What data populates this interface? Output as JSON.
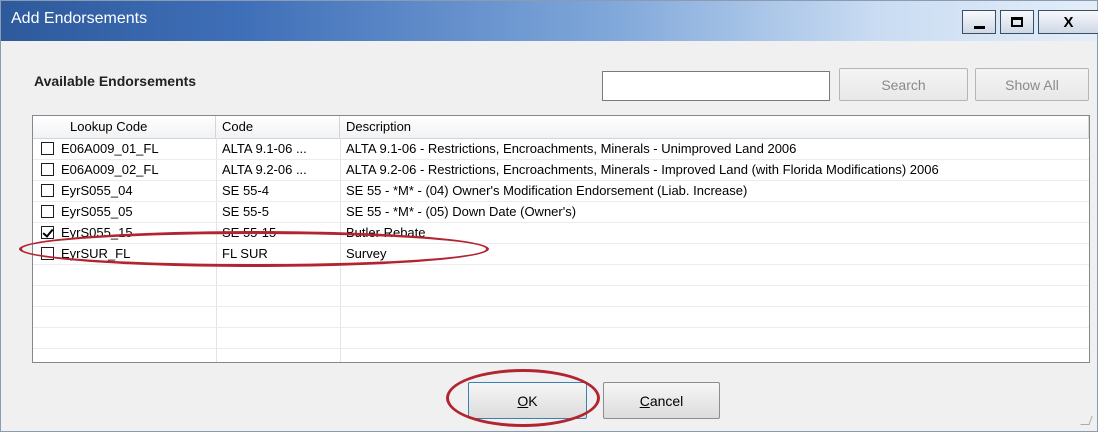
{
  "window": {
    "title": "Add Endorsements",
    "controls": {
      "close_glyph": "X"
    }
  },
  "group": {
    "label": "Available Endorsements"
  },
  "search": {
    "value": "",
    "button_label": "Search",
    "show_all_label": "Show All"
  },
  "table": {
    "columns": [
      "Lookup Code",
      "Code",
      "Description"
    ],
    "rows": [
      {
        "checked": false,
        "lookup": "E06A009_01_FL",
        "code": "ALTA 9.1-06 ...",
        "description": "ALTA 9.1-06 - Restrictions, Encroachments, Minerals - Unimproved Land 2006"
      },
      {
        "checked": false,
        "lookup": "E06A009_02_FL",
        "code": "ALTA 9.2-06 ...",
        "description": "ALTA 9.2-06 - Restrictions, Encroachments, Minerals - Improved Land (with Florida Modifications) 2006"
      },
      {
        "checked": false,
        "lookup": "EyrS055_04",
        "code": "SE 55-4",
        "description": "SE 55 - *M* - (04) Owner's Modification Endorsement (Liab. Increase)"
      },
      {
        "checked": false,
        "lookup": "EyrS055_05",
        "code": "SE 55-5",
        "description": "SE 55 - *M* - (05) Down Date (Owner's)"
      },
      {
        "checked": true,
        "lookup": "EyrS055_15",
        "code": "SE 55-15",
        "description": "Butler Rebate"
      },
      {
        "checked": false,
        "lookup": "EyrSUR_FL",
        "code": "FL SUR",
        "description": "Survey"
      }
    ]
  },
  "actions": {
    "ok_label": {
      "mnemonic": "O",
      "rest": "K"
    },
    "cancel_label": {
      "mnemonic": "C",
      "rest": "ancel"
    }
  },
  "colors": {
    "annotation": "#b2242f",
    "titlebar_start": "#2e5a9c",
    "titlebar_end": "#e4eef9"
  }
}
